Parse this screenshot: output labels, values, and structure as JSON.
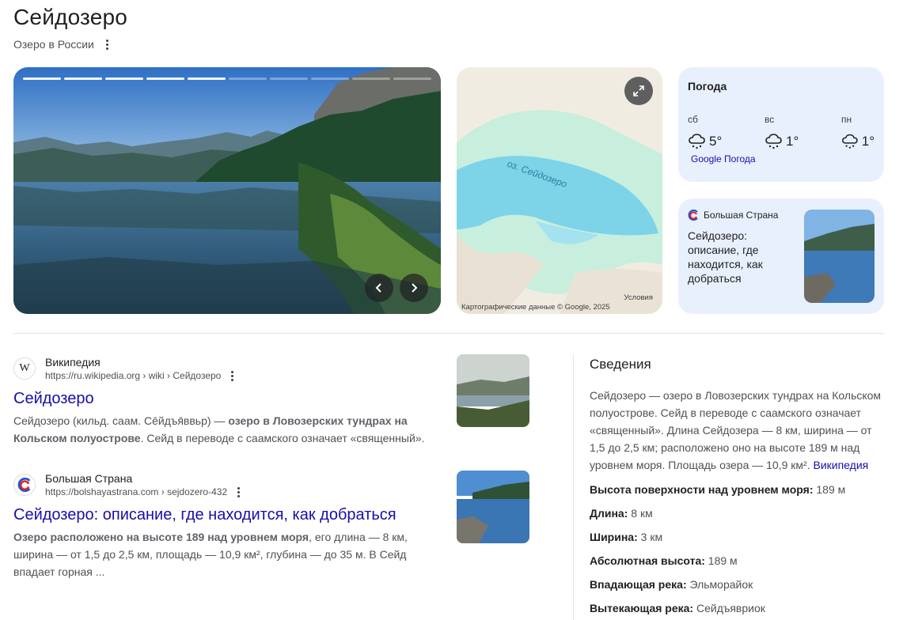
{
  "header": {
    "title": "Сейдозеро",
    "subtitle": "Озеро в России"
  },
  "photo": {
    "segments": 10,
    "active_segment": 5
  },
  "map": {
    "lake_label": "оз. Сейдозеро",
    "attribution": "Картографические данные © Google, 2025",
    "terms": "Условия"
  },
  "weather": {
    "title": "Погода",
    "days": [
      {
        "name": "сб",
        "temp": "5°",
        "icon": "snow-cloud-icon"
      },
      {
        "name": "вс",
        "temp": "1°",
        "icon": "snow-cloud-icon"
      },
      {
        "name": "пн",
        "temp": "1°",
        "icon": "snow-cloud-icon"
      }
    ],
    "link": "Google Погода"
  },
  "promo_card": {
    "source": "Большая Страна",
    "title": "Сейдозеро: описание, где находится, как добраться"
  },
  "results": [
    {
      "site": "Википедия",
      "url": "https://ru.wikipedia.org › wiki › Сейдозеро",
      "title": "Сейдозеро",
      "snippet_pre": "Сейдозеро (кильд. саам. Се̄йдъя̄ввьр) — ",
      "snippet_bold": "озеро в Ловозерских тундрах на Кольском полуострове",
      "snippet_post": ". Сейд в переводе с саамского означает «священный»."
    },
    {
      "site": "Большая Страна",
      "url": "https://bolshayastrana.com › sejdozero-432",
      "title": "Сейдозеро: описание, где находится, как добраться",
      "snippet_bold": "Озеро расположено на высоте 189 над уровнем моря",
      "snippet_post": ", его длина — 8 км, ширина — от 1,5 до 2,5 км, площадь — 10,9 км², глубина — до 35 м. В Сейд впадает горная ..."
    }
  ],
  "knowledge_panel": {
    "heading": "Сведения",
    "description": "Сейдозеро — озеро в Ловозерских тундрах на Кольском полуострове. Сейд в переводе с саамского означает «священный». Длина Сейдозера — 8 км, ширина — от 1,5 до 2,5 км; расположено оно на высоте 189 м над уровнем моря. Площадь озера — 10,9 км².",
    "source_link": "Википедия",
    "facts": [
      {
        "label": "Высота поверхности над уровнем моря:",
        "value": "189 м"
      },
      {
        "label": "Длина:",
        "value": "8 км"
      },
      {
        "label": "Ширина:",
        "value": "3 км"
      },
      {
        "label": "Абсолютная высота:",
        "value": "189 м"
      },
      {
        "label": "Впадающая река:",
        "value": "Эльморайок"
      },
      {
        "label": "Вытекающая река:",
        "value": "Сейдъявриок"
      }
    ]
  }
}
